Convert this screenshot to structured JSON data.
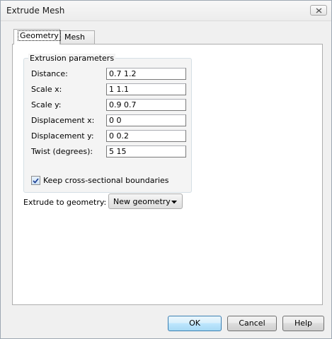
{
  "window": {
    "title": "Extrude Mesh",
    "close_icon": "close-icon"
  },
  "tabs": [
    {
      "label": "Geometry",
      "active": true
    },
    {
      "label": "Mesh",
      "active": false
    }
  ],
  "extrusion_parameters": {
    "legend": "Extrusion parameters",
    "fields": [
      {
        "label": "Distance:",
        "value": "0.7 1.2"
      },
      {
        "label": "Scale x:",
        "value": "1 1.1"
      },
      {
        "label": "Scale y:",
        "value": "0.9 0.7"
      },
      {
        "label": "Displacement x:",
        "value": "0 0"
      },
      {
        "label": "Displacement y:",
        "value": "0 0.2"
      },
      {
        "label": "Twist (degrees):",
        "value": "5 15"
      }
    ],
    "keep_boundaries": {
      "label": "Keep cross-sectional boundaries",
      "checked": true
    }
  },
  "extrude_to": {
    "label": "Extrude to geometry:",
    "selected": "New geometry"
  },
  "buttons": {
    "ok": "OK",
    "cancel": "Cancel",
    "help": "Help"
  },
  "colors": {
    "accent": "#3c7fb1",
    "check": "#1c3f94"
  }
}
